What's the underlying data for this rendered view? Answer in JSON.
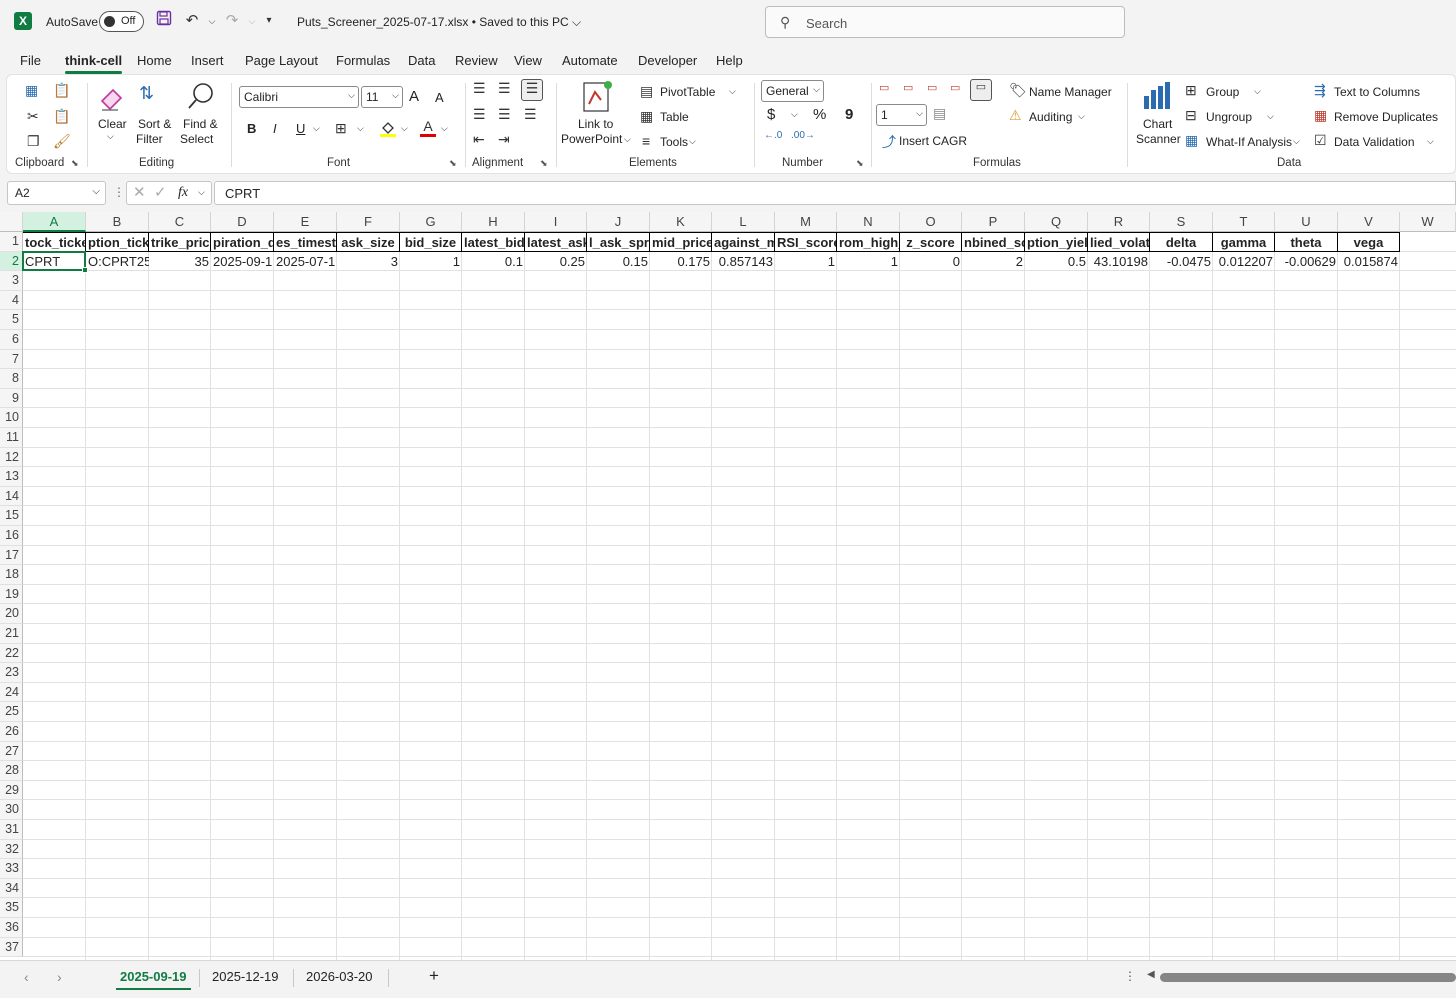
{
  "titlebar": {
    "app_icon": "excel-icon",
    "app_letter": "X",
    "autosave_label": "AutoSave",
    "autosave_state": "Off",
    "document_title": "Puts_Screener_2025-07-17.xlsx • Saved to this PC ⌵",
    "search_placeholder": "Search"
  },
  "menu": {
    "tabs": [
      "File",
      "think-cell",
      "Home",
      "Insert",
      "Page Layout",
      "Formulas",
      "Data",
      "Review",
      "View",
      "Automate",
      "Developer",
      "Help"
    ],
    "active": "think-cell"
  },
  "ribbon": {
    "clipboard": {
      "label": "Clipboard"
    },
    "editing": {
      "label": "Editing",
      "clear": "Clear",
      "sort_filter_1": "Sort &",
      "sort_filter_2": "Filter",
      "find_select_1": "Find &",
      "find_select_2": "Select"
    },
    "font": {
      "label": "Font",
      "font_name": "Calibri",
      "font_size": "11",
      "bold": "B",
      "italic": "I",
      "underline": "U",
      "grow": "A",
      "shrink": "A",
      "font_color": "A"
    },
    "alignment": {
      "label": "Alignment"
    },
    "elements": {
      "label": "Elements",
      "link_1": "Link to",
      "link_2": "PowerPoint",
      "pivot": "PivotTable",
      "table": "Table",
      "tools": "Tools"
    },
    "number": {
      "label": "Number",
      "format": "General",
      "currency": "$",
      "percent": "%",
      "comma": "9"
    },
    "formulas": {
      "label": "Formulas",
      "decimal_value": "1",
      "name_manager": "Name Manager",
      "auditing": "Auditing",
      "insert_cagr": "Insert CAGR"
    },
    "chart_scanner": {
      "line1": "Chart",
      "line2": "Scanner"
    },
    "data": {
      "label": "Data",
      "group": "Group",
      "ungroup": "Ungroup",
      "what_if": "What-If Analysis",
      "text_to_columns": "Text to Columns",
      "remove_duplicates": "Remove Duplicates",
      "data_validation": "Data Validation"
    }
  },
  "formula_bar": {
    "name_box": "A2",
    "fx": "fx",
    "content": "CPRT"
  },
  "sheet": {
    "columns": [
      "A",
      "B",
      "C",
      "D",
      "E",
      "F",
      "G",
      "H",
      "I",
      "J",
      "K",
      "L",
      "M",
      "N",
      "O",
      "P",
      "Q",
      "R",
      "S",
      "T",
      "U",
      "V",
      "W"
    ],
    "headers": [
      "tock_ticke",
      "ption_ticke",
      "trike_pric",
      "piration_d",
      "es_timest",
      "ask_size",
      "bid_size",
      "latest_bid",
      "latest_ask",
      "l_ask_spre",
      "mid_price",
      "against_m",
      "RSI_score",
      "rom_high_",
      "z_score",
      "nbined_sc",
      "ption_yiel",
      "lied_volat",
      "delta",
      "gamma",
      "theta",
      "vega"
    ],
    "row2": [
      "CPRT",
      "O:CPRT25",
      "35",
      "2025-09-1",
      "2025-07-1",
      "3",
      "1",
      "0.1",
      "0.25",
      "0.15",
      "0.175",
      "0.857143",
      "1",
      "1",
      "0",
      "2",
      "0.5",
      "43.10198",
      "-0.0475",
      "0.012207",
      "-0.00629",
      "0.015874"
    ],
    "row_count": 37
  },
  "sheet_tabs": {
    "tabs": [
      "2025-09-19",
      "2025-12-19",
      "2026-03-20"
    ],
    "active": "2025-09-19",
    "add": "+"
  }
}
